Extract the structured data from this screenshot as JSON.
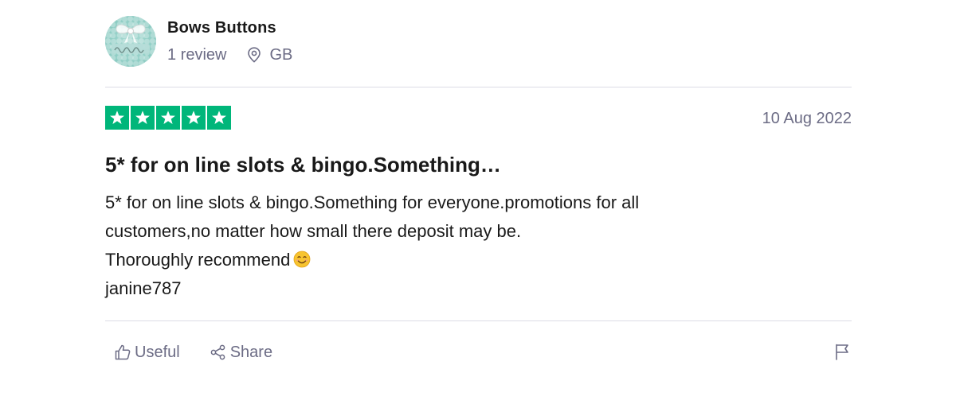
{
  "reviewer": {
    "name": "Bows Buttons",
    "reviews_count": "1 review",
    "country": "GB",
    "avatar_colors": {
      "base": "#8ecdc4",
      "bow": "#ffffff"
    }
  },
  "review": {
    "rating": 5,
    "rating_max": 5,
    "star_color": "#00b67a",
    "date": "10 Aug 2022",
    "title": "5* for on line slots & bingo.Something…",
    "body_lines": [
      "5* for on line slots & bingo.Something for everyone.promotions for all",
      "customers,no matter how small there deposit may be.",
      "Thoroughly recommend",
      "janine787"
    ]
  },
  "actions": {
    "useful_label": "Useful",
    "share_label": "Share",
    "useful_icon": "thumbs-up-icon",
    "share_icon": "share-icon",
    "flag_icon": "flag-icon"
  },
  "colors": {
    "text_primary": "#191919",
    "text_secondary": "#6c6c85",
    "divider": "#dcdce6"
  }
}
